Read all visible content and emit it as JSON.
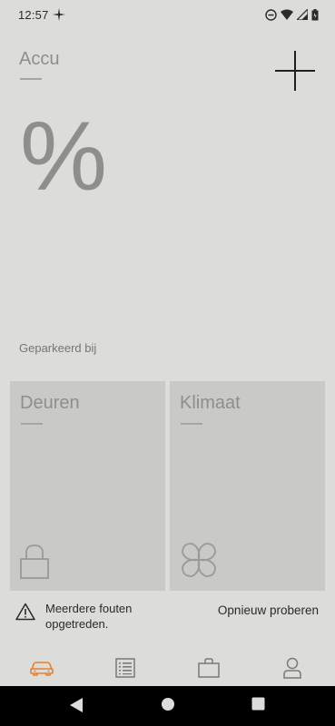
{
  "status_bar": {
    "time": "12:57",
    "icons": [
      "spark-icon",
      "do-not-disturb-icon",
      "wifi-icon",
      "signal-icon",
      "battery-icon"
    ]
  },
  "header": {
    "title": "Accu",
    "add_icon": "plus-icon"
  },
  "battery": {
    "percent_text": "%",
    "parked_label": "Geparkeerd bij"
  },
  "cards": {
    "doors": {
      "title": "Deuren",
      "icon": "lock-icon"
    },
    "climate": {
      "title": "Klimaat",
      "icon": "fan-icon"
    }
  },
  "error": {
    "message": "Meerdere fouten opgetreden.",
    "retry_label": "Opnieuw proberen",
    "icon": "warning-icon"
  },
  "tabs": [
    {
      "name": "car",
      "icon": "car-icon",
      "active": true
    },
    {
      "name": "list",
      "icon": "list-icon",
      "active": false
    },
    {
      "name": "shop",
      "icon": "bag-icon",
      "active": false
    },
    {
      "name": "profile",
      "icon": "person-icon",
      "active": false
    }
  ],
  "colors": {
    "background": "#dcdcd8",
    "card": "#c9c9c6",
    "accent": "#e8812f",
    "text_muted": "#8e8e8c",
    "text_dark": "#2a2a2a"
  },
  "nav": [
    "back-icon",
    "home-icon",
    "recents-icon"
  ]
}
